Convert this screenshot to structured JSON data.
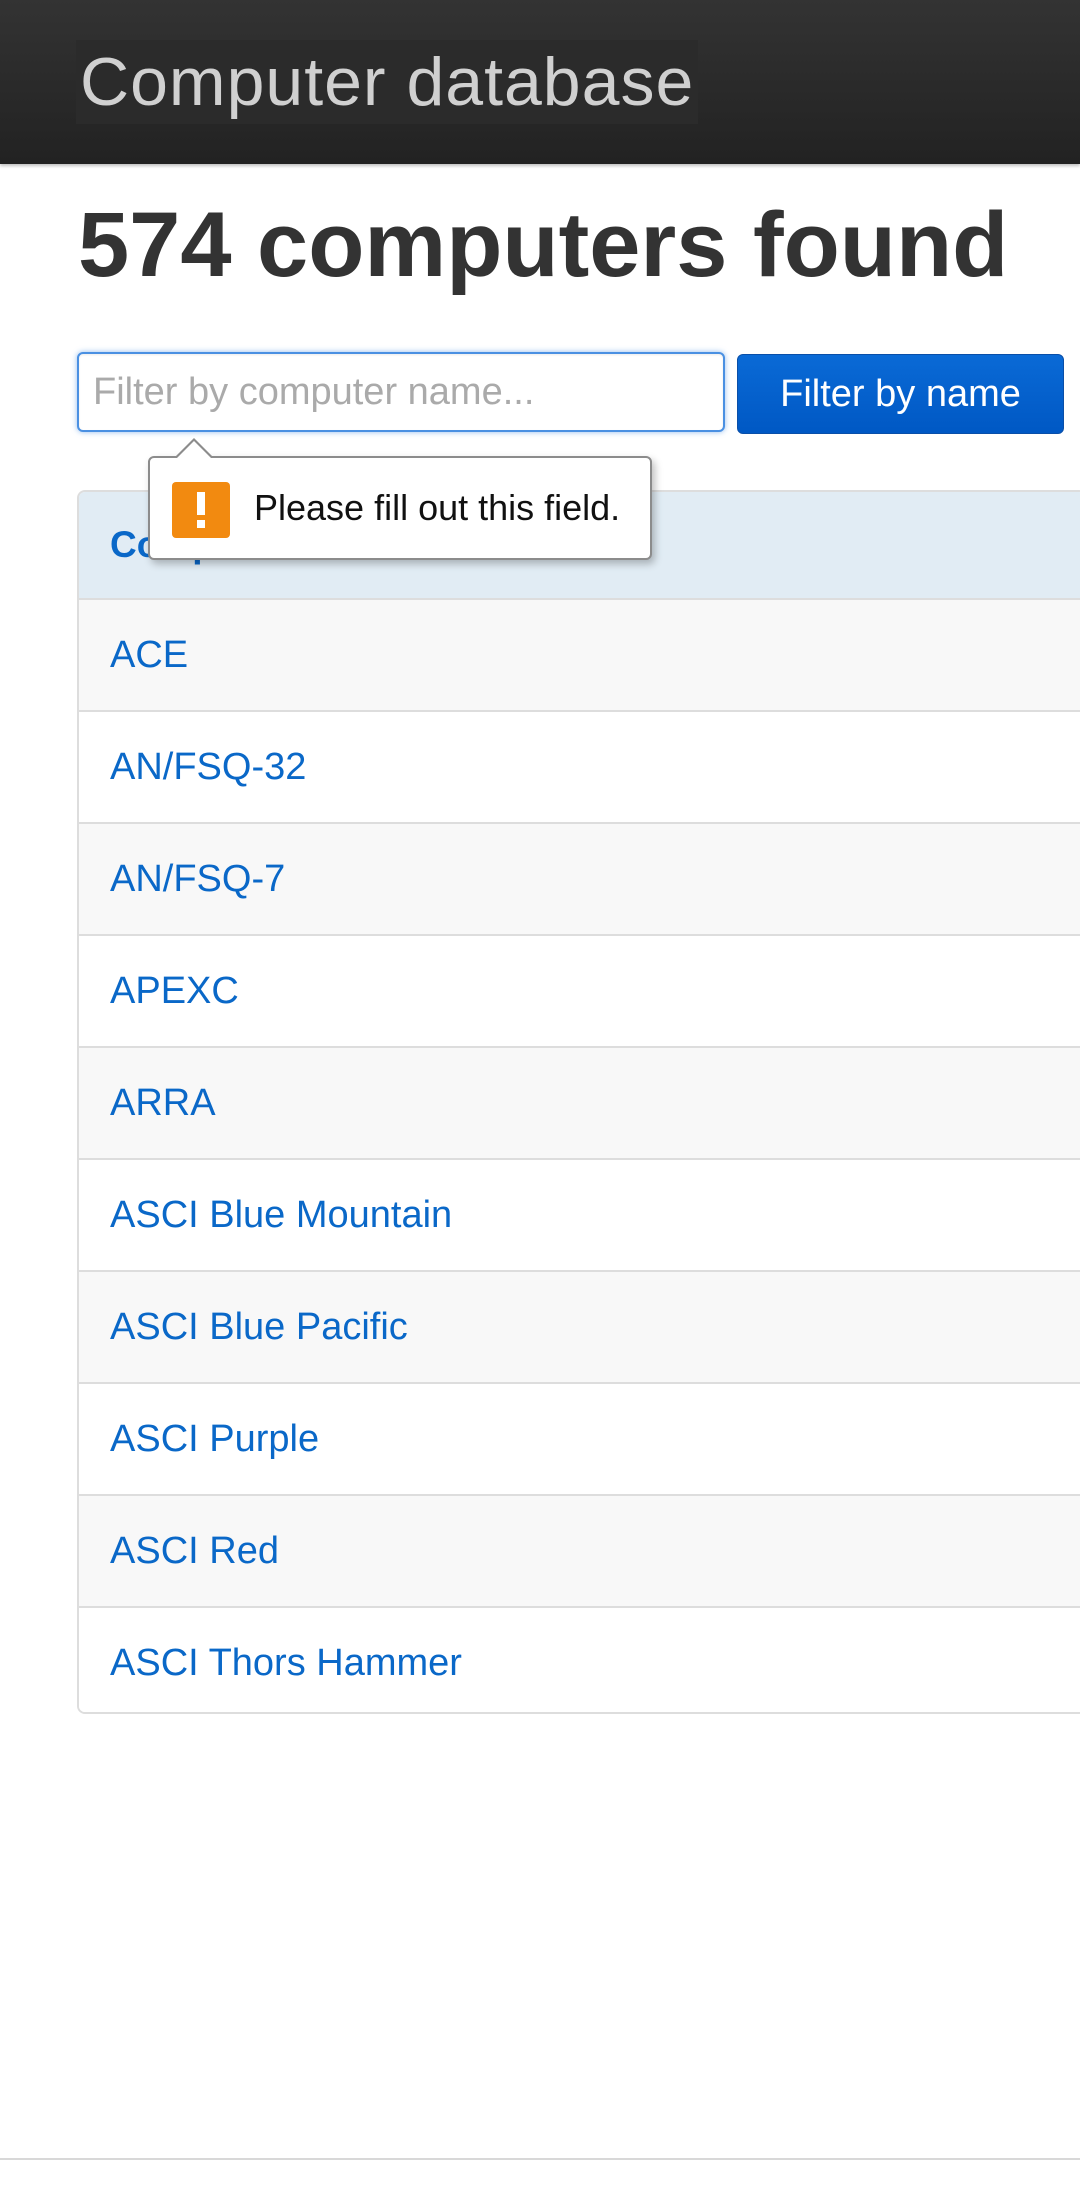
{
  "header": {
    "brand": "Computer database"
  },
  "main": {
    "title": "574 computers found",
    "filter": {
      "placeholder": "Filter by computer name...",
      "value": "",
      "button_label": "Filter by name"
    },
    "validation_tooltip": {
      "icon": "warning-icon",
      "message": "Please fill out this field.",
      "icon_color": "#f28a10"
    },
    "table": {
      "columns": [
        "Computer name"
      ],
      "rows": [
        "ACE",
        "AN/FSQ-32",
        "AN/FSQ-7",
        "APEXC",
        "ARRA",
        "ASCI Blue Mountain",
        "ASCI Blue Pacific",
        "ASCI Purple",
        "ASCI Red",
        "ASCI Thors Hammer"
      ]
    }
  },
  "colors": {
    "topbar": "#222222",
    "link": "#0a68c8",
    "primary_button": "#0061cf",
    "header_row": "#e1ecf4"
  }
}
